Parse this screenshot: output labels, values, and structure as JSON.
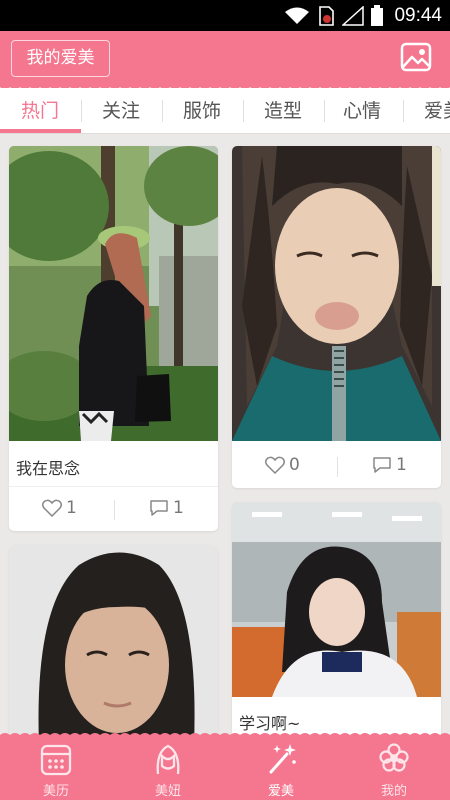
{
  "status_bar": {
    "time": "09:44"
  },
  "header": {
    "title_button": "我的爱美"
  },
  "tabs": [
    {
      "label": "热门",
      "active": true
    },
    {
      "label": "关注",
      "active": false
    },
    {
      "label": "服饰",
      "active": false
    },
    {
      "label": "造型",
      "active": false
    },
    {
      "label": "心情",
      "active": false
    },
    {
      "label": "爱美",
      "active": false
    }
  ],
  "feed": {
    "left": [
      {
        "caption": "我在思念",
        "likes": "1",
        "comments": "1"
      },
      {
        "caption": "",
        "likes": "",
        "comments": ""
      }
    ],
    "right": [
      {
        "caption": "",
        "likes": "0",
        "comments": "1"
      },
      {
        "caption": "学习啊~",
        "likes": "",
        "comments": ""
      }
    ]
  },
  "bottom_nav": [
    {
      "label": "美历",
      "icon": "calendar-icon",
      "active": false
    },
    {
      "label": "美妞",
      "icon": "girl-icon",
      "active": false
    },
    {
      "label": "爱美",
      "icon": "magic-wand-icon",
      "active": true
    },
    {
      "label": "我的",
      "icon": "flower-icon",
      "active": false
    }
  ],
  "colors": {
    "brand": "#f5768f",
    "background": "#ebe8e8"
  }
}
